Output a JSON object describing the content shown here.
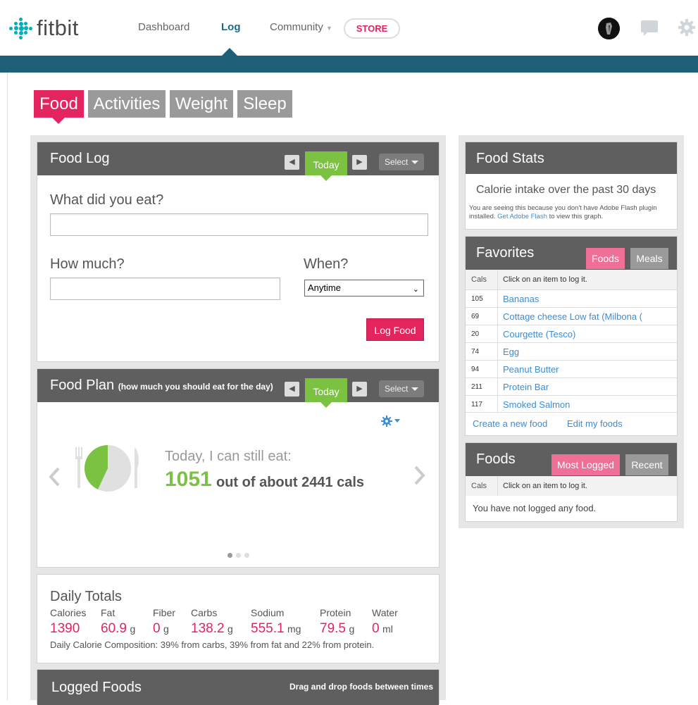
{
  "brand": {
    "name": "fitbit"
  },
  "nav": {
    "dashboard": "Dashboard",
    "log": "Log",
    "community": "Community",
    "store": "STORE"
  },
  "tabs": {
    "food": "Food",
    "activities": "Activities",
    "weight": "Weight",
    "sleep": "Sleep"
  },
  "food_log": {
    "title": "Food Log",
    "today": "Today",
    "select": "Select",
    "what_label": "What did you eat?",
    "what_value": "",
    "how_much_label": "How much?",
    "how_much_value": "",
    "when_label": "When?",
    "when_value": "Anytime",
    "log_button": "Log Food"
  },
  "food_plan": {
    "title": "Food Plan",
    "subtitle": "(how much you should eat for the day)",
    "today": "Today",
    "select": "Select",
    "headline": "Today, I can still eat:",
    "remaining": "1051",
    "out_of": "out of about 2441 cals",
    "pie_eaten_fraction": 0.43,
    "colors": {
      "remaining": "#7bc242",
      "plate": "#e0e0e0"
    }
  },
  "daily_totals": {
    "title": "Daily Totals",
    "items": [
      {
        "label": "Calories",
        "value": "1390",
        "unit": ""
      },
      {
        "label": "Fat",
        "value": "60.9",
        "unit": "g"
      },
      {
        "label": "Fiber",
        "value": "0",
        "unit": "g"
      },
      {
        "label": "Carbs",
        "value": "138.2",
        "unit": "g"
      },
      {
        "label": "Sodium",
        "value": "555.1",
        "unit": "mg"
      },
      {
        "label": "Protein",
        "value": "79.5",
        "unit": "g"
      },
      {
        "label": "Water",
        "value": "0",
        "unit": "ml"
      }
    ],
    "composition": "Daily Calorie Composition: 39% from carbs, 39% from fat and 22% from protein."
  },
  "logged_foods": {
    "title": "Logged Foods",
    "hint": "Drag and drop foods between times"
  },
  "food_stats": {
    "title": "Food Stats",
    "subtitle": "Calorie intake over the past 30 days",
    "flash_note_1": "You are seeing this because you don't have Adobe Flash plugin installed.",
    "flash_link": "Get Adobe Flash",
    "flash_note_2": "to view this graph."
  },
  "favorites": {
    "title": "Favorites",
    "tab_foods": "Foods",
    "tab_meals": "Meals",
    "col_cals": "Cals",
    "col_hint": "Click on an item to log it.",
    "items": [
      {
        "cals": "105",
        "name": "Bananas"
      },
      {
        "cals": "69",
        "name": "Cottage cheese Low fat (Milbona ("
      },
      {
        "cals": "20",
        "name": "Courgette (Tesco)"
      },
      {
        "cals": "74",
        "name": "Egg"
      },
      {
        "cals": "94",
        "name": "Peanut Butter"
      },
      {
        "cals": "211",
        "name": "Protein Bar"
      },
      {
        "cals": "117",
        "name": "Smoked Salmon"
      }
    ],
    "create_link": "Create a new food",
    "edit_link": "Edit my foods"
  },
  "foods_panel": {
    "title": "Foods",
    "tab_most": "Most Logged",
    "tab_recent": "Recent",
    "col_cals": "Cals",
    "col_hint": "Click on an item to log it.",
    "empty": "You have not logged any food."
  }
}
